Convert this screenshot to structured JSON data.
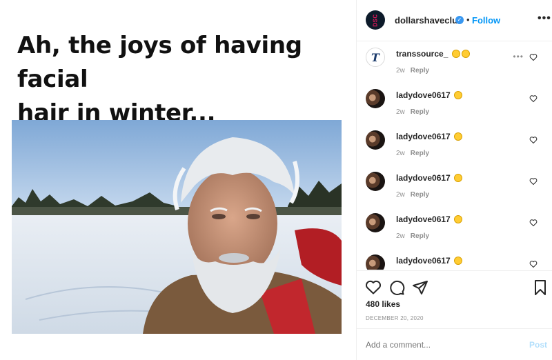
{
  "post": {
    "caption_line1": "Ah, the joys of having facial",
    "caption_line2": "hair in winter..."
  },
  "header": {
    "avatar_text": "DSC",
    "username": "dollarshaveclub",
    "verified_mark": "✓",
    "separator": "•",
    "follow_label": "Follow",
    "more_label": "•••"
  },
  "comments": [
    {
      "username": "transsource_",
      "emojis": [
        "grinning-face",
        "laughing-face"
      ],
      "age": "2w",
      "reply_label": "Reply",
      "avatar_icon": "transsource-logo",
      "avatar_letter": "T"
    },
    {
      "username": "ladydove0617",
      "emojis": [
        "rolling-on-floor-laughing"
      ],
      "age": "2w",
      "reply_label": "Reply",
      "avatar_icon": "profile-photo"
    },
    {
      "username": "ladydove0617",
      "emojis": [
        "rolling-on-floor-laughing"
      ],
      "age": "2w",
      "reply_label": "Reply",
      "avatar_icon": "profile-photo"
    },
    {
      "username": "ladydove0617",
      "emojis": [
        "rolling-on-floor-laughing"
      ],
      "age": "2w",
      "reply_label": "Reply",
      "avatar_icon": "profile-photo"
    },
    {
      "username": "ladydove0617",
      "emojis": [
        "rolling-on-floor-laughing"
      ],
      "age": "2w",
      "reply_label": "Reply",
      "avatar_icon": "profile-photo"
    },
    {
      "username": "ladydove0617",
      "emojis": [
        "rolling-on-floor-laughing"
      ],
      "age": "",
      "reply_label": "",
      "avatar_icon": "profile-photo"
    }
  ],
  "actions": {
    "likes": "480 likes",
    "date": "DECEMBER 20, 2020"
  },
  "add_comment": {
    "placeholder": "Add a comment...",
    "post_label": "Post"
  },
  "colors": {
    "accent": "#0095f6",
    "post_disabled": "#b2dffc",
    "verified": "#3897f0",
    "brand_pink": "#e5175b"
  }
}
